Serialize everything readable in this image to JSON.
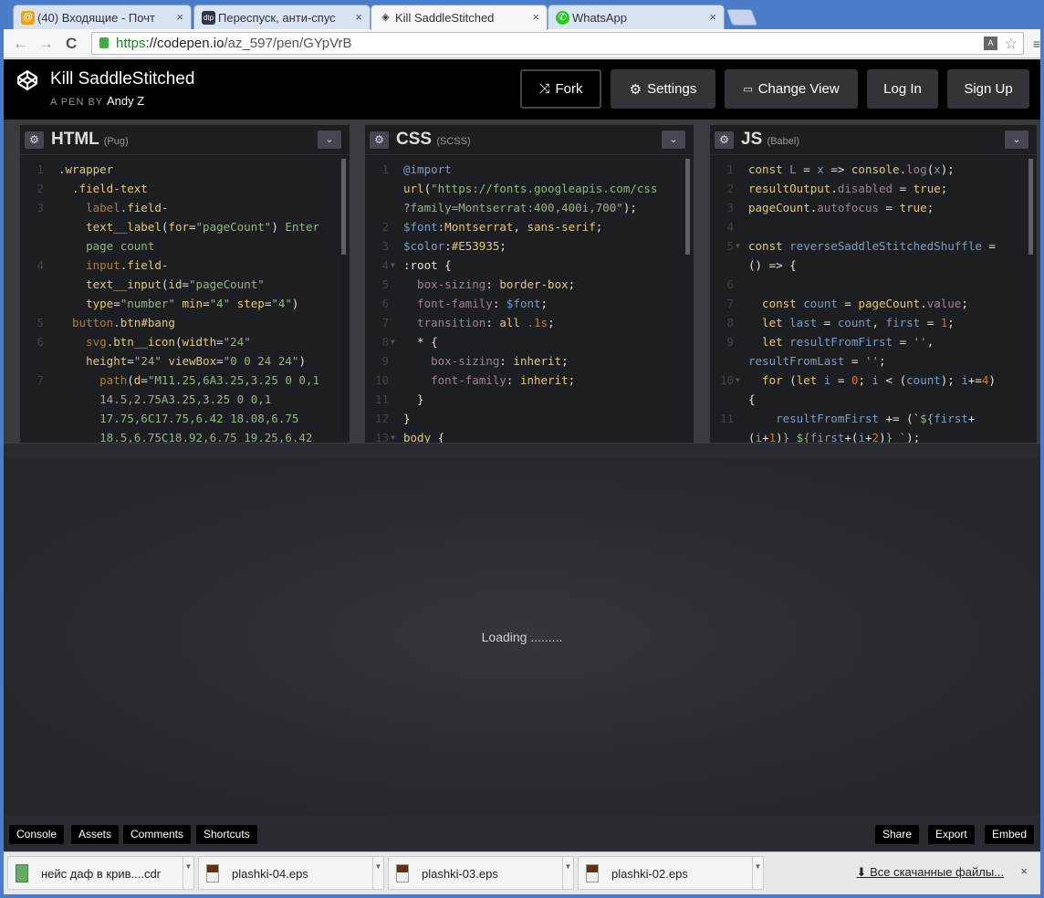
{
  "browser": {
    "tabs": [
      {
        "label": "(40) Входящие - Почт",
        "icon": "@"
      },
      {
        "label": "Переспуск, анти-спус",
        "icon": "dtp"
      },
      {
        "label": "Kill SaddleStitched",
        "icon": "◈"
      },
      {
        "label": "WhatsApp",
        "icon": "✆"
      }
    ],
    "url_scheme": "https",
    "url_host": "://codepen.io",
    "url_path": "/az_597/pen/GYpVrB"
  },
  "header": {
    "title": "Kill SaddleStitched",
    "by_label": "A PEN BY",
    "author": "Andy Z",
    "buttons": {
      "fork": "Fork",
      "settings": "Settings",
      "change_view": "Change View",
      "login": "Log In",
      "signup": "Sign Up"
    }
  },
  "editors": [
    {
      "name": "HTML",
      "sub": "(Pug)",
      "lines": [
        {
          "n": "1",
          "t": [
            [
              ".wrapper",
              "t-sel"
            ]
          ]
        },
        {
          "n": "2",
          "t": [
            [
              "  .field-text",
              "t-sel"
            ]
          ]
        },
        {
          "n": "3",
          "t": [
            [
              "    label",
              "t-tag"
            ],
            [
              ".field-",
              "t-sel"
            ]
          ]
        },
        {
          "n": "",
          "t": [
            [
              "    text__label",
              "t-sel"
            ],
            [
              "(",
              "t-def"
            ],
            [
              "for",
              "t-sel"
            ],
            [
              "=",
              "t-def"
            ],
            [
              "\"pageCount\"",
              "t-str"
            ],
            [
              ") ",
              "t-def"
            ],
            [
              "Enter",
              "t-str"
            ]
          ]
        },
        {
          "n": "",
          "t": [
            [
              "    page count",
              "t-str"
            ]
          ]
        },
        {
          "n": "4",
          "t": [
            [
              "    input",
              "t-tag"
            ],
            [
              ".field-",
              "t-sel"
            ]
          ]
        },
        {
          "n": "",
          "t": [
            [
              "    text__input",
              "t-sel"
            ],
            [
              "(",
              "t-def"
            ],
            [
              "id",
              "t-sel"
            ],
            [
              "=",
              "t-def"
            ],
            [
              "\"pageCount\"",
              "t-str"
            ]
          ]
        },
        {
          "n": "",
          "t": [
            [
              "    type",
              "t-sel"
            ],
            [
              "=",
              "t-def"
            ],
            [
              "\"number\" ",
              "t-str"
            ],
            [
              "min",
              "t-sel"
            ],
            [
              "=",
              "t-def"
            ],
            [
              "\"4\" ",
              "t-str"
            ],
            [
              "step",
              "t-sel"
            ],
            [
              "=",
              "t-def"
            ],
            [
              "\"4\"",
              "t-str"
            ],
            [
              ")",
              "t-def"
            ]
          ]
        },
        {
          "n": "5",
          "t": [
            [
              "  button",
              "t-tag"
            ],
            [
              ".btn#bang",
              "t-sel"
            ]
          ]
        },
        {
          "n": "6",
          "t": [
            [
              "    svg",
              "t-tag"
            ],
            [
              ".btn__icon",
              "t-sel"
            ],
            [
              "(",
              "t-def"
            ],
            [
              "width",
              "t-sel"
            ],
            [
              "=",
              "t-def"
            ],
            [
              "\"24\"",
              "t-str"
            ]
          ]
        },
        {
          "n": "",
          "t": [
            [
              "    height",
              "t-sel"
            ],
            [
              "=",
              "t-def"
            ],
            [
              "\"24\" ",
              "t-str"
            ],
            [
              "viewBox",
              "t-sel"
            ],
            [
              "=",
              "t-def"
            ],
            [
              "\"0 0 24 24\"",
              "t-str"
            ],
            [
              ")",
              "t-def"
            ]
          ]
        },
        {
          "n": "7",
          "t": [
            [
              "      path",
              "t-tag"
            ],
            [
              "(",
              "t-def"
            ],
            [
              "d",
              "t-sel"
            ],
            [
              "=",
              "t-def"
            ],
            [
              "\"M11.25,6A3.25,3.25 0 0,1",
              "t-str"
            ]
          ]
        },
        {
          "n": "",
          "t": [
            [
              "      14.5,2.75A3.25,3.25 0 0,1",
              "t-str"
            ]
          ]
        },
        {
          "n": "",
          "t": [
            [
              "      17.75,6C17.75,6.42 18.08,6.75",
              "t-str"
            ]
          ]
        },
        {
          "n": "",
          "t": [
            [
              "      18.5,6.75C18.92,6.75 19.25,6.42",
              "t-str"
            ]
          ]
        }
      ]
    },
    {
      "name": "CSS",
      "sub": "(SCSS)",
      "lines": [
        {
          "n": "1",
          "t": [
            [
              "@import",
              "t-var"
            ]
          ]
        },
        {
          "n": "",
          "t": [
            [
              "url",
              "t-sel"
            ],
            [
              "(",
              "t-def"
            ],
            [
              "\"https://fonts.googleapis.com/css",
              "t-str"
            ]
          ]
        },
        {
          "n": "",
          "t": [
            [
              "?family=Montserrat:400,400i,700\"",
              "t-str"
            ],
            [
              ");",
              "t-def"
            ]
          ]
        },
        {
          "n": "2",
          "t": [
            [
              "$font",
              "t-var"
            ],
            [
              ":",
              "t-def"
            ],
            [
              "Montserrat",
              "t-sel"
            ],
            [
              ", ",
              "t-def"
            ],
            [
              "sans-serif",
              "t-sel"
            ],
            [
              ";",
              "t-def"
            ]
          ]
        },
        {
          "n": "3",
          "t": [
            [
              "$color",
              "t-var"
            ],
            [
              ":",
              "t-def"
            ],
            [
              "#E53935",
              "t-sel"
            ],
            [
              ";",
              "t-def"
            ]
          ]
        },
        {
          "n": "4",
          "f": true,
          "t": [
            [
              ":root {",
              "t-def"
            ]
          ]
        },
        {
          "n": "5",
          "t": [
            [
              "  box-sizing",
              "t-prop"
            ],
            [
              ": ",
              "t-def"
            ],
            [
              "border-box",
              "t-sel"
            ],
            [
              ";",
              "t-def"
            ]
          ]
        },
        {
          "n": "6",
          "t": [
            [
              "  font-family",
              "t-prop"
            ],
            [
              ": ",
              "t-def"
            ],
            [
              "$font",
              "t-var"
            ],
            [
              ";",
              "t-def"
            ]
          ]
        },
        {
          "n": "7",
          "t": [
            [
              "  transition",
              "t-prop"
            ],
            [
              ": ",
              "t-def"
            ],
            [
              "all ",
              "t-sel"
            ],
            [
              ".1s",
              "t-num"
            ],
            [
              ";",
              "t-def"
            ]
          ]
        },
        {
          "n": "8",
          "f": true,
          "t": [
            [
              "  * {",
              "t-def"
            ]
          ]
        },
        {
          "n": "9",
          "t": [
            [
              "    box-sizing",
              "t-prop"
            ],
            [
              ": ",
              "t-def"
            ],
            [
              "inherit",
              "t-sel"
            ],
            [
              ";",
              "t-def"
            ]
          ]
        },
        {
          "n": "10",
          "t": [
            [
              "    font-family",
              "t-prop"
            ],
            [
              ": ",
              "t-def"
            ],
            [
              "inherit",
              "t-sel"
            ],
            [
              ";",
              "t-def"
            ]
          ]
        },
        {
          "n": "11",
          "t": [
            [
              "  }",
              "t-def"
            ]
          ]
        },
        {
          "n": "12",
          "t": [
            [
              "}",
              "t-def"
            ]
          ]
        },
        {
          "n": "13",
          "f": true,
          "t": [
            [
              "body",
              "t-sel"
            ],
            [
              " {",
              "t-def"
            ]
          ]
        }
      ]
    },
    {
      "name": "JS",
      "sub": "(Babel)",
      "lines": [
        {
          "n": "1",
          "t": [
            [
              "const ",
              "t-sel"
            ],
            [
              "L",
              "t-var"
            ],
            [
              " = ",
              "t-def"
            ],
            [
              "x",
              "t-var"
            ],
            [
              " => ",
              "t-def"
            ],
            [
              "console",
              "t-sel"
            ],
            [
              ".",
              "t-def"
            ],
            [
              "log",
              "t-prop"
            ],
            [
              "(",
              "t-def"
            ],
            [
              "x",
              "t-var"
            ],
            [
              ");",
              "t-def"
            ]
          ]
        },
        {
          "n": "2",
          "t": [
            [
              "resultOutput",
              "t-sel"
            ],
            [
              ".",
              "t-def"
            ],
            [
              "disabled",
              "t-prop"
            ],
            [
              " = ",
              "t-def"
            ],
            [
              "true",
              "t-sel"
            ],
            [
              ";",
              "t-def"
            ]
          ]
        },
        {
          "n": "3",
          "t": [
            [
              "pageCount",
              "t-sel"
            ],
            [
              ".",
              "t-def"
            ],
            [
              "autofocus",
              "t-prop"
            ],
            [
              " = ",
              "t-def"
            ],
            [
              "true",
              "t-sel"
            ],
            [
              ";",
              "t-def"
            ]
          ]
        },
        {
          "n": "4",
          "t": []
        },
        {
          "n": "5",
          "f": true,
          "t": [
            [
              "const ",
              "t-sel"
            ],
            [
              "reverseSaddleStitchedShuffle",
              "t-var"
            ],
            [
              " =",
              "t-def"
            ]
          ]
        },
        {
          "n": "",
          "t": [
            [
              "() => {",
              "t-def"
            ]
          ]
        },
        {
          "n": "6",
          "t": []
        },
        {
          "n": "7",
          "t": [
            [
              "  const ",
              "t-sel"
            ],
            [
              "count",
              "t-var"
            ],
            [
              " = ",
              "t-def"
            ],
            [
              "pageCount",
              "t-sel"
            ],
            [
              ".",
              "t-def"
            ],
            [
              "value",
              "t-prop"
            ],
            [
              ";",
              "t-def"
            ]
          ]
        },
        {
          "n": "8",
          "t": [
            [
              "  let ",
              "t-sel"
            ],
            [
              "last",
              "t-var"
            ],
            [
              " = ",
              "t-def"
            ],
            [
              "count",
              "t-var"
            ],
            [
              ", ",
              "t-def"
            ],
            [
              "first",
              "t-var"
            ],
            [
              " = ",
              "t-def"
            ],
            [
              "1",
              "t-num"
            ],
            [
              ";",
              "t-def"
            ]
          ]
        },
        {
          "n": "9",
          "t": [
            [
              "  let ",
              "t-sel"
            ],
            [
              "resultFromFirst",
              "t-var"
            ],
            [
              " = ",
              "t-def"
            ],
            [
              "''",
              "t-str"
            ],
            [
              ",",
              "t-def"
            ]
          ]
        },
        {
          "n": "",
          "t": [
            [
              "resultFromLast",
              "t-var"
            ],
            [
              " = ",
              "t-def"
            ],
            [
              "''",
              "t-str"
            ],
            [
              ";",
              "t-def"
            ]
          ]
        },
        {
          "n": "10",
          "f": true,
          "t": [
            [
              "  for ",
              "t-sel"
            ],
            [
              "(",
              "t-def"
            ],
            [
              "let ",
              "t-sel"
            ],
            [
              "i",
              "t-var"
            ],
            [
              " = ",
              "t-def"
            ],
            [
              "0",
              "t-num"
            ],
            [
              "; ",
              "t-def"
            ],
            [
              "i",
              "t-var"
            ],
            [
              " < (",
              "t-def"
            ],
            [
              "count",
              "t-var"
            ],
            [
              "); ",
              "t-def"
            ],
            [
              "i",
              "t-var"
            ],
            [
              "+=",
              "t-def"
            ],
            [
              "4",
              "t-num"
            ],
            [
              ")",
              "t-def"
            ]
          ]
        },
        {
          "n": "",
          "t": [
            [
              "{",
              "t-def"
            ]
          ]
        },
        {
          "n": "11",
          "t": [
            [
              "    resultFromFirst",
              "t-var"
            ],
            [
              " += (`",
              "t-def"
            ],
            [
              "${",
              "t-str"
            ],
            [
              "first",
              "t-var"
            ],
            [
              "+",
              "t-def"
            ]
          ]
        },
        {
          "n": "",
          "t": [
            [
              "(",
              "t-def"
            ],
            [
              "i",
              "t-var"
            ],
            [
              "+",
              "t-def"
            ],
            [
              "1",
              "t-num"
            ],
            [
              ")",
              "t-def"
            ],
            [
              "} ${",
              "t-str"
            ],
            [
              "first",
              "t-var"
            ],
            [
              "+(",
              "t-def"
            ],
            [
              "i",
              "t-var"
            ],
            [
              "+",
              "t-def"
            ],
            [
              "2",
              "t-num"
            ],
            [
              ")",
              "t-def"
            ],
            [
              "} `",
              "t-str"
            ],
            [
              ");",
              "t-def"
            ]
          ]
        }
      ]
    }
  ],
  "preview": {
    "loading": "Loading ........."
  },
  "footer": {
    "left": [
      "Console",
      "Assets",
      "Comments",
      "Shortcuts"
    ],
    "right": [
      "Share",
      "Export",
      "Embed"
    ]
  },
  "downloads": {
    "items": [
      "нейс даф в крив....cdr",
      "plashki-04.eps",
      "plashki-03.eps",
      "plashki-02.eps"
    ],
    "all": "Все скачанные файлы...",
    "close": "×"
  }
}
